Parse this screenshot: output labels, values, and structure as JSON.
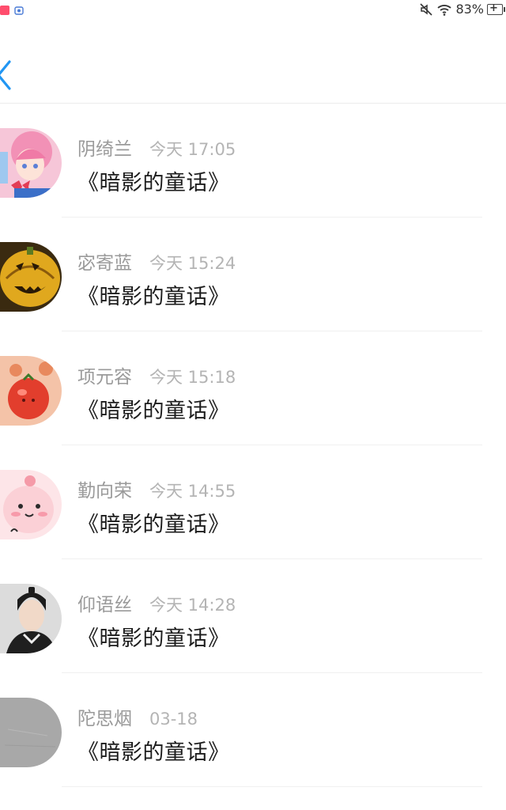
{
  "status_bar": {
    "battery_percent": "83%",
    "icons": [
      "app-badge-icon",
      "app-icon",
      "mute-icon",
      "wifi-icon",
      "battery-charging-icon"
    ]
  },
  "nav": {
    "back_icon": "chevron-left-icon",
    "accent_color": "#2196F3"
  },
  "comments": [
    {
      "username": "阴绮兰",
      "time": "今天 17:05",
      "message": "《暗影的童话》",
      "avatar": "anime-girl"
    },
    {
      "username": "宓寄蓝",
      "time": "今天 15:24",
      "message": "《暗影的童话》",
      "avatar": "pumpkin"
    },
    {
      "username": "项元容",
      "time": "今天 15:18",
      "message": "《暗影的童话》",
      "avatar": "tomato"
    },
    {
      "username": "勤向荣",
      "time": "今天 14:55",
      "message": "《暗影的童话》",
      "avatar": "pink-cartoon"
    },
    {
      "username": "仰语丝",
      "time": "今天 14:28",
      "message": "《暗影的童话》",
      "avatar": "portrait"
    },
    {
      "username": "陀思烟",
      "time": "03-18",
      "message": "《暗影的童话》",
      "avatar": "gray"
    }
  ]
}
